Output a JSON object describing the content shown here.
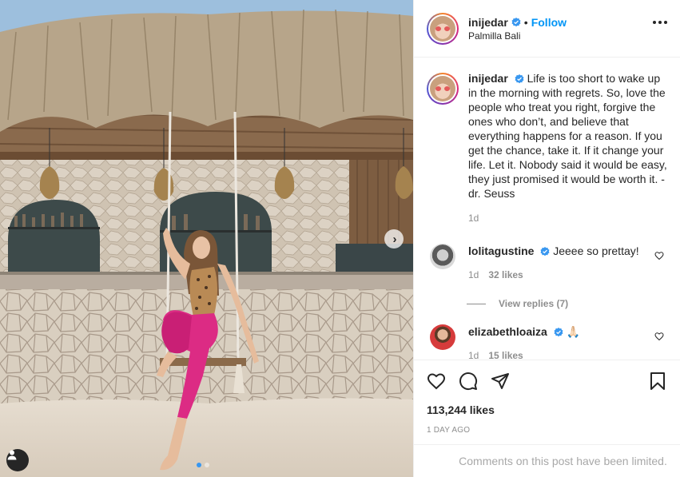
{
  "post": {
    "username": "inijedar",
    "follow_label": "Follow",
    "location": "Palmilla Bali",
    "caption": "Life is too short to wake up in the morning with regrets. So, love the people who treat you right, forgive the ones who don’t, and believe that everything happens for a reason. If you get the chance, take it. If it change your life. Let it. Nobody said it would be easy, they just promised it would be worth it. -dr. Seuss",
    "caption_age": "1d",
    "likes_text": "113,244 likes",
    "date_text": "1 DAY AGO",
    "comments_limited_text": "Comments on this post have been limited.",
    "carousel": {
      "slides": 2,
      "active": 0
    }
  },
  "comments": [
    {
      "username": "lolitagustine",
      "text": "Jeeee so prettay!",
      "age": "1d",
      "likes": "32 likes",
      "view_replies": "View replies (7)"
    },
    {
      "username": "elizabethloaiza",
      "text": "🙏🏻",
      "age": "1d",
      "likes": "15 likes"
    }
  ],
  "colors": {
    "accent": "#0095f6",
    "verified": "#3897f0",
    "muted": "#8e8e8e",
    "dot_active": "#3897f0"
  },
  "icons": [
    "verified-badge-icon",
    "more-options-icon",
    "heart-icon",
    "comment-icon",
    "share-icon",
    "save-icon",
    "chevron-right-icon",
    "user-tag-icon"
  ]
}
